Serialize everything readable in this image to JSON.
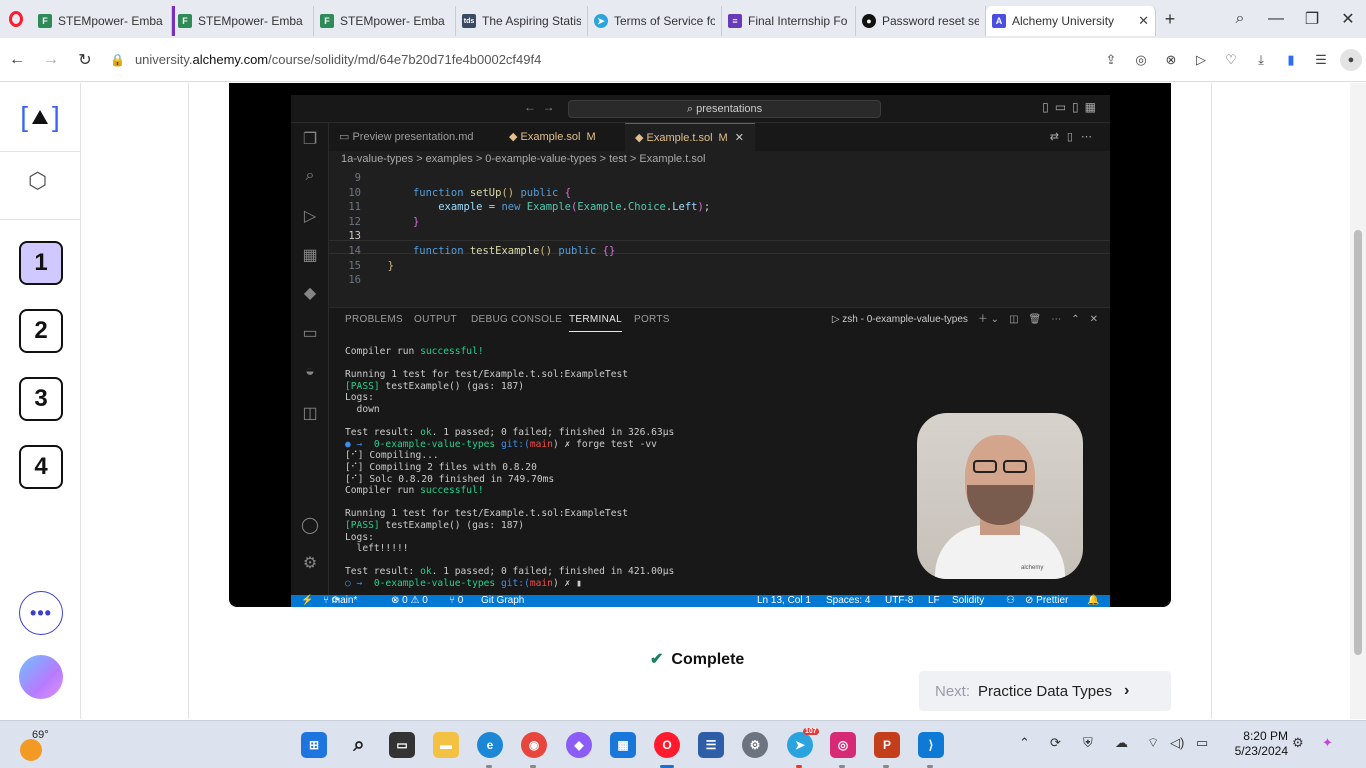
{
  "browser": {
    "tabs": [
      {
        "title": "STEMpower- Emba",
        "favicon": "stempower-icon",
        "color": "#2e8b57"
      },
      {
        "title": "STEMpower- Emba",
        "favicon": "stempower-icon",
        "color": "#2e8b57"
      },
      {
        "title": "STEMpower- Emba",
        "favicon": "stempower-icon",
        "color": "#2e8b57"
      },
      {
        "title": "The Aspiring Statist",
        "favicon": "tds-icon",
        "color": "#3a4a64"
      },
      {
        "title": "Terms of Service fo",
        "favicon": "telegram-icon",
        "color": "#2aa3df"
      },
      {
        "title": "Final Internship Fo",
        "favicon": "forms-icon",
        "color": "#673ab7"
      },
      {
        "title": "Password reset sen",
        "favicon": "github-icon",
        "color": "#111111"
      },
      {
        "title": "Alchemy University",
        "favicon": "alchemy-icon",
        "color": "#4a4fe0"
      }
    ],
    "url_host": "university.",
    "url_domain": "alchemy.com",
    "url_path": "/course/solidity/md/64e7b20d71fe4b0002cf49f4"
  },
  "sidebar": {
    "steps": [
      "1",
      "2",
      "3",
      "4"
    ],
    "more_label": "•••"
  },
  "video": {
    "vscode": {
      "search": "presentations",
      "tabs": [
        {
          "name": "Preview presentation.md",
          "mod": ""
        },
        {
          "name": "Example.sol",
          "mod": "M"
        },
        {
          "name": "Example.t.sol",
          "mod": "M"
        }
      ],
      "breadcrumb": "1a-value-types  >  examples  >  0-example-value-types  >  test  >  Example.t.sol",
      "panel_tabs": [
        "PROBLEMS",
        "OUTPUT",
        "DEBUG CONSOLE",
        "TERMINAL",
        "PORTS"
      ],
      "terminal_name": "zsh - 0-example-value-types",
      "terminal_lines": {
        "l1a": "Compiler run ",
        "l1b": "successful!",
        "l2": "Running 1 test for test/Example.t.sol:ExampleTest",
        "l3a": "[PASS]",
        "l3b": " testExample() (gas: 187)",
        "l4": "Logs:",
        "l5": "  down",
        "l6a": "Test result: ",
        "l6b": "ok",
        "l6c": ". 1 passed; 0 failed; finished in 326.63µs",
        "p1a": "● → ",
        "p1b": " 0-example-value-types ",
        "p1c": "git:(",
        "p1d": "main",
        "p1e": ") ✗ forge test -vv",
        "c1": "[⠊] Compiling...",
        "c2": "[⠊] Compiling 2 files with 0.8.20",
        "c3": "[⠊] Solc 0.8.20 finished in 749.70ms",
        "c4a": "Compiler run ",
        "c4b": "successful!",
        "r2": "Running 1 test for test/Example.t.sol:ExampleTest",
        "r3a": "[PASS]",
        "r3b": " testExample() (gas: 187)",
        "r4": "Logs:",
        "r5": "  left!!!!!",
        "r6a": "Test result: ",
        "r6b": "ok",
        "r6c": ". 1 passed; 0 failed; finished in 421.00µs",
        "p2a": "○ → ",
        "p2b": " 0-example-value-types ",
        "p2c": "git:(",
        "p2d": "main",
        "p2e": ") ✗ ▮"
      },
      "status": {
        "branch": "main*",
        "errors": "⊗ 0 ⚠ 0",
        "ports": "⑂ 0",
        "git_graph": "Git Graph",
        "position": "Ln 13, Col 1",
        "spaces": "Spaces: 4",
        "encoding": "UTF-8",
        "eol": "LF",
        "language": "Solidity",
        "prettier": "⊘ Prettier"
      },
      "watermark": "alchemy"
    }
  },
  "lesson": {
    "complete_label": "Complete",
    "next_prefix": "Next:",
    "next_title": "Practice Data Types"
  },
  "taskbar": {
    "temperature": "69°",
    "time": "8:20 PM",
    "date": "5/23/2024",
    "telegram_badge": "107"
  }
}
